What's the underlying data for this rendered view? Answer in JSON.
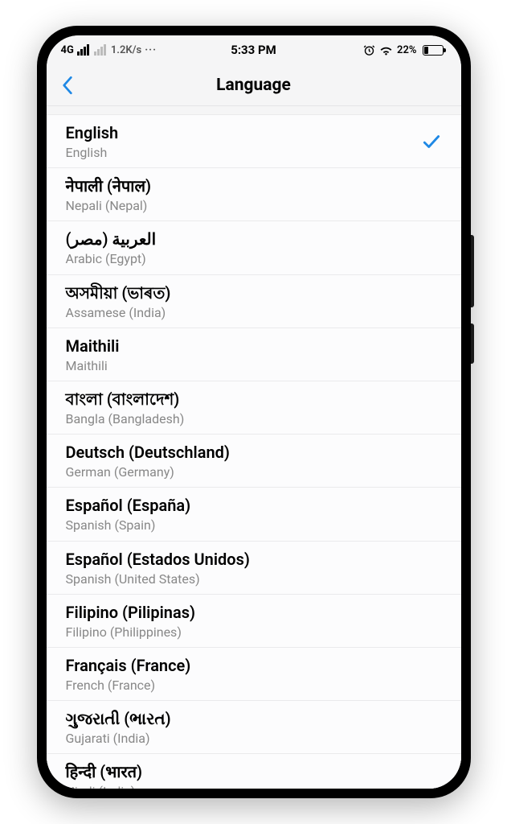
{
  "statusBar": {
    "networkLabel": "4G",
    "speed": "1.2K/s",
    "time": "5:33 PM",
    "batteryPercent": "22%"
  },
  "header": {
    "title": "Language"
  },
  "languages": [
    {
      "native": "English",
      "english": "English",
      "selected": true
    },
    {
      "native": "नेपाली (नेपाल)",
      "english": "Nepali (Nepal)",
      "selected": false
    },
    {
      "native": "العربية (مصر)",
      "english": "Arabic (Egypt)",
      "selected": false
    },
    {
      "native": "অসমীয়া (ভাৰত)",
      "english": "Assamese (India)",
      "selected": false
    },
    {
      "native": "Maithili",
      "english": "Maithili",
      "selected": false
    },
    {
      "native": "বাংলা (বাংলাদেশ)",
      "english": "Bangla (Bangladesh)",
      "selected": false
    },
    {
      "native": "Deutsch (Deutschland)",
      "english": "German (Germany)",
      "selected": false
    },
    {
      "native": "Español (España)",
      "english": "Spanish (Spain)",
      "selected": false
    },
    {
      "native": "Español (Estados Unidos)",
      "english": "Spanish (United States)",
      "selected": false
    },
    {
      "native": "Filipino (Pilipinas)",
      "english": "Filipino (Philippines)",
      "selected": false
    },
    {
      "native": "Français (France)",
      "english": "French (France)",
      "selected": false
    },
    {
      "native": "ગુજરાતી (ભારત)",
      "english": "Gujarati (India)",
      "selected": false
    },
    {
      "native": "हिन्दी (भारत)",
      "english": "Hindi (India)",
      "selected": false
    }
  ]
}
